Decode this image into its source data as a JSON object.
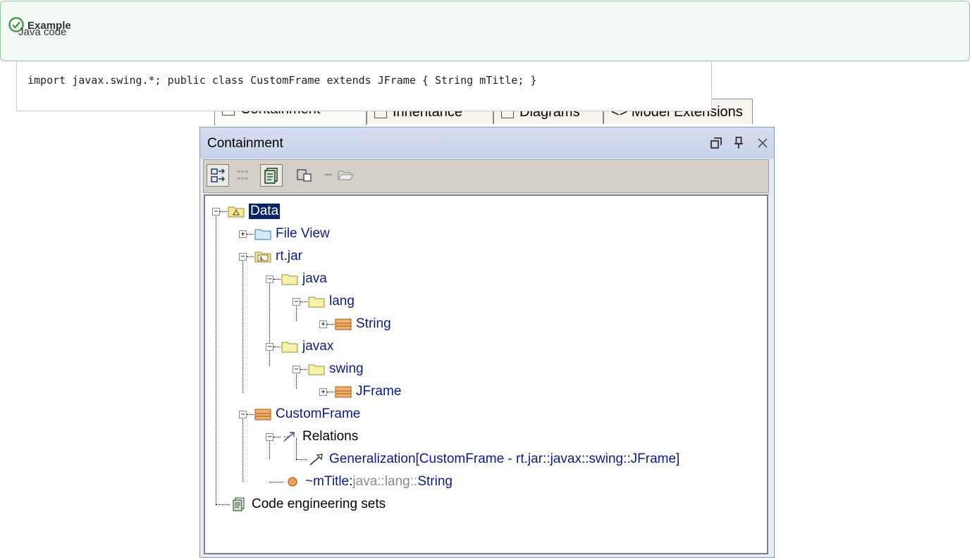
{
  "example": {
    "title": "Example",
    "subtitle": "Java code"
  },
  "code": {
    "text": "import javax.swing.*; public class CustomFrame extends JFrame { String mTitle; }"
  },
  "tabs": [
    {
      "label": "Containment"
    },
    {
      "label": "Inheritance"
    },
    {
      "label": "Diagrams"
    },
    {
      "label": "Model Extensions"
    }
  ],
  "panel": {
    "title": "Containment",
    "header_buttons": {
      "restore": "⧉",
      "pin": "ꟼ",
      "close": "✕"
    }
  },
  "tree": {
    "nodes": [
      {
        "label": "Data",
        "icon": "model-icon"
      },
      {
        "label": "File View",
        "icon": "folder-icon"
      },
      {
        "label": "rt.jar",
        "icon": "library-icon"
      },
      {
        "label": "java",
        "icon": "package-icon"
      },
      {
        "label": "lang",
        "icon": "package-icon"
      },
      {
        "label": "String",
        "icon": "class-icon"
      },
      {
        "label": "javax",
        "icon": "package-icon"
      },
      {
        "label": "swing",
        "icon": "package-icon"
      },
      {
        "label": "JFrame",
        "icon": "class-icon"
      },
      {
        "label": "CustomFrame",
        "icon": "class-icon"
      },
      {
        "label": "Relations",
        "icon": "relations-icon"
      },
      {
        "label": "Generalization[CustomFrame - rt.jar::javax::swing::JFrame]",
        "icon": "generalization-icon"
      },
      {
        "label": "~mTitle",
        "sep": " : ",
        "type": "java::lang::",
        "type_end": "String",
        "icon": "property-icon"
      },
      {
        "label": "Code engineering sets",
        "icon": "code-sets-icon"
      }
    ]
  },
  "colors": {
    "selected_bg": "#0a246a",
    "tree_text": "#0a1a8c",
    "panel_header": "#c9d2ec",
    "example_border": "#91c89c"
  }
}
